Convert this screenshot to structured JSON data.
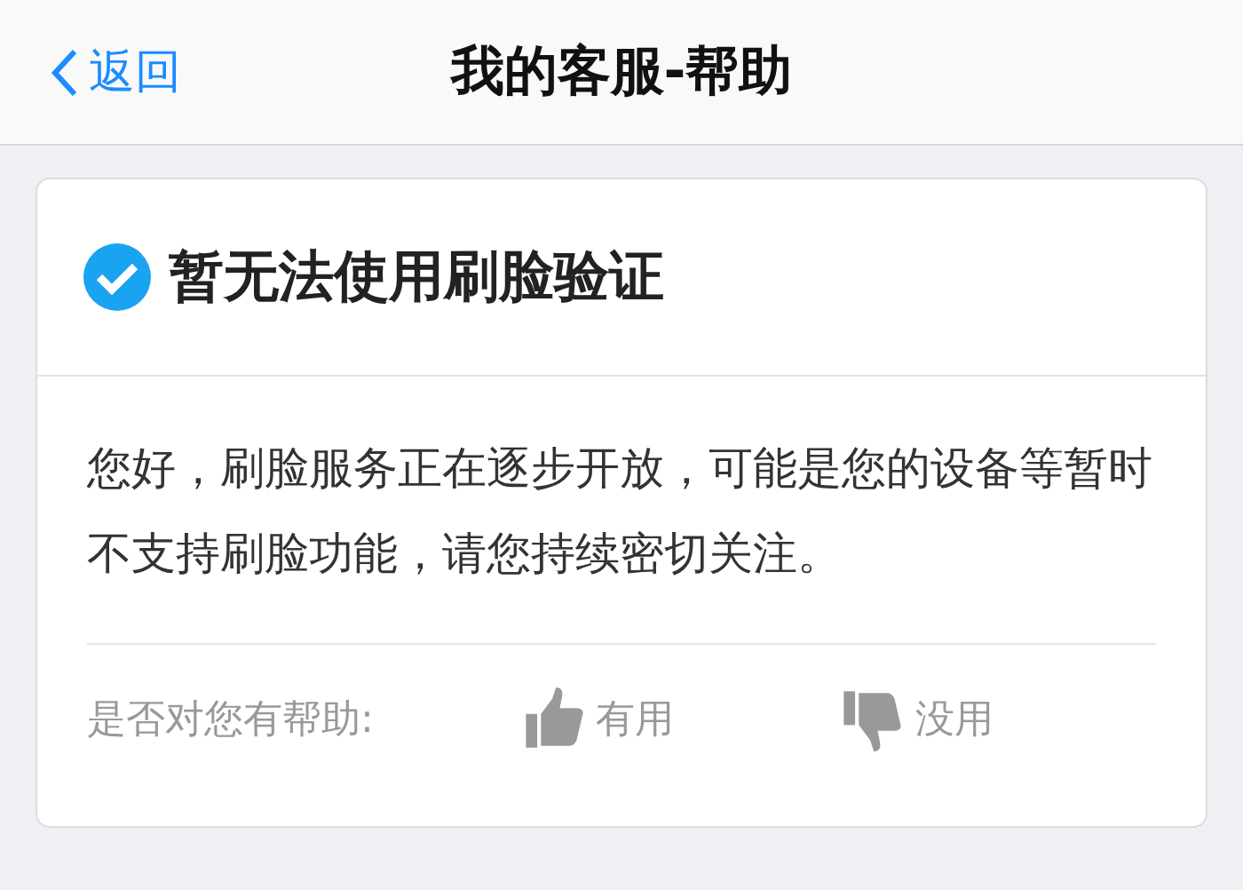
{
  "nav": {
    "back": "返回",
    "title": "我的客服-帮助"
  },
  "card": {
    "title": "暂无法使用刷脸验证",
    "checked": true,
    "body": "您好，刷脸服务正在逐步开放，可能是您的设备等暂时不支持刷脸功能，请您持续密切关注。",
    "feedback": {
      "prompt": "是否对您有帮助:",
      "options": [
        {
          "kind": "up",
          "label": "有用"
        },
        {
          "kind": "down",
          "label": "没用"
        }
      ]
    }
  }
}
